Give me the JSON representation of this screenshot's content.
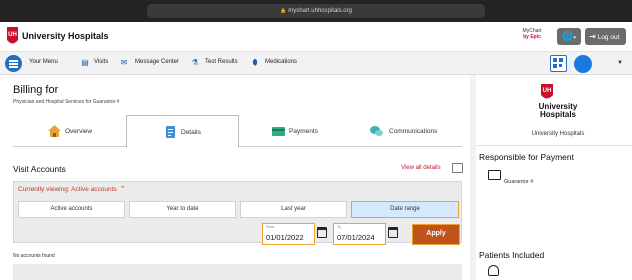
{
  "browser": {
    "url": "myshart.uhhospitals.org"
  },
  "header": {
    "brand": "University Hospitals",
    "mychart": {
      "line1": "MyChart",
      "line2": "by Epic"
    },
    "logout_label": "Log out"
  },
  "nav": {
    "menu_label": "Your Menu",
    "items": [
      {
        "label": "Visits",
        "icon": "clipboard-icon"
      },
      {
        "label": "Message Center",
        "icon": "envelope-icon"
      },
      {
        "label": "Test Results",
        "icon": "flask-icon"
      },
      {
        "label": "Medications",
        "icon": "pill-icon"
      }
    ]
  },
  "main": {
    "title": "Billing for",
    "subtitle": "Physician and Hospital Services for Guarantor #",
    "tabs": [
      {
        "label": "Overview",
        "icon": "house-icon"
      },
      {
        "label": "Details",
        "icon": "document-icon"
      },
      {
        "label": "Payments",
        "icon": "credit-card-icon"
      },
      {
        "label": "Communications",
        "icon": "chat-bubbles-icon"
      }
    ],
    "active_tab": "Details",
    "visit_accounts": {
      "title": "Visit Accounts",
      "view_all": "View all details",
      "viewing": "Currently viewing: Active accounts",
      "filters": [
        "Active accounts",
        "Year to date",
        "Last year",
        "Date range"
      ],
      "selected_filter": "Date range",
      "from": {
        "label": "From",
        "value": "01/01/2022"
      },
      "to": {
        "label": "To",
        "value": "07/01/2024"
      },
      "apply_label": "Apply",
      "no_accounts": "No accounts found"
    }
  },
  "right": {
    "logo_text": "University Hospitals",
    "org_name": "University Hospitals",
    "responsible_title": "Responsible for Payment",
    "guarantor": "Guarantor #",
    "patients_title": "Patients Included"
  },
  "colors": {
    "accent_red": "#c8102e",
    "highlight_orange": "#f0a133",
    "apply_fill": "#c0521b",
    "nav_blue": "#1f6fc6",
    "selected_filter_fill": "#d6e8fb"
  }
}
